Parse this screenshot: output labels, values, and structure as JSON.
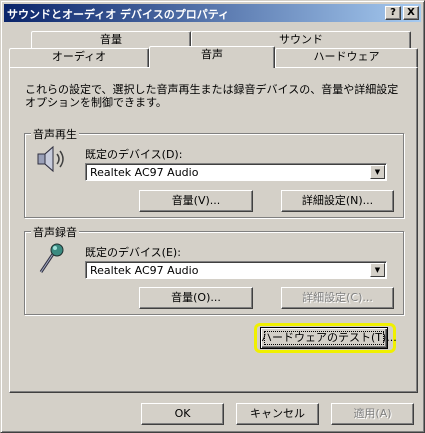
{
  "window": {
    "title": "サウンドとオーディオ デバイスのプロパティ",
    "help_label": "?",
    "close_label": "X"
  },
  "tabs": {
    "back_row": [
      "音量",
      "サウンド"
    ],
    "front_row": [
      "オーディオ",
      "音声",
      "ハードウェア"
    ],
    "active": "音声"
  },
  "description": "これらの設定で、選択した音声再生または録音デバイスの、音量や詳細設定オプションを制御できます。",
  "playback": {
    "group_label": "音声再生",
    "device_label": "既定のデバイス(D):",
    "device_value": "Realtek AC97 Audio",
    "volume_button": "音量(V)...",
    "advanced_button": "詳細設定(N)..."
  },
  "recording": {
    "group_label": "音声録音",
    "device_label": "既定のデバイス(E):",
    "device_value": "Realtek AC97 Audio",
    "volume_button": "音量(O)...",
    "advanced_button": "詳細設定(C)..."
  },
  "test_hardware_button": "ハードウェアのテスト(T)...",
  "footer": {
    "ok": "OK",
    "cancel": "キャンセル",
    "apply": "適用(A)"
  },
  "colors": {
    "titlebar_start": "#0a246a",
    "titlebar_end": "#a6caf0",
    "face": "#d4d0c8",
    "highlight_ring": "#f0f000"
  }
}
